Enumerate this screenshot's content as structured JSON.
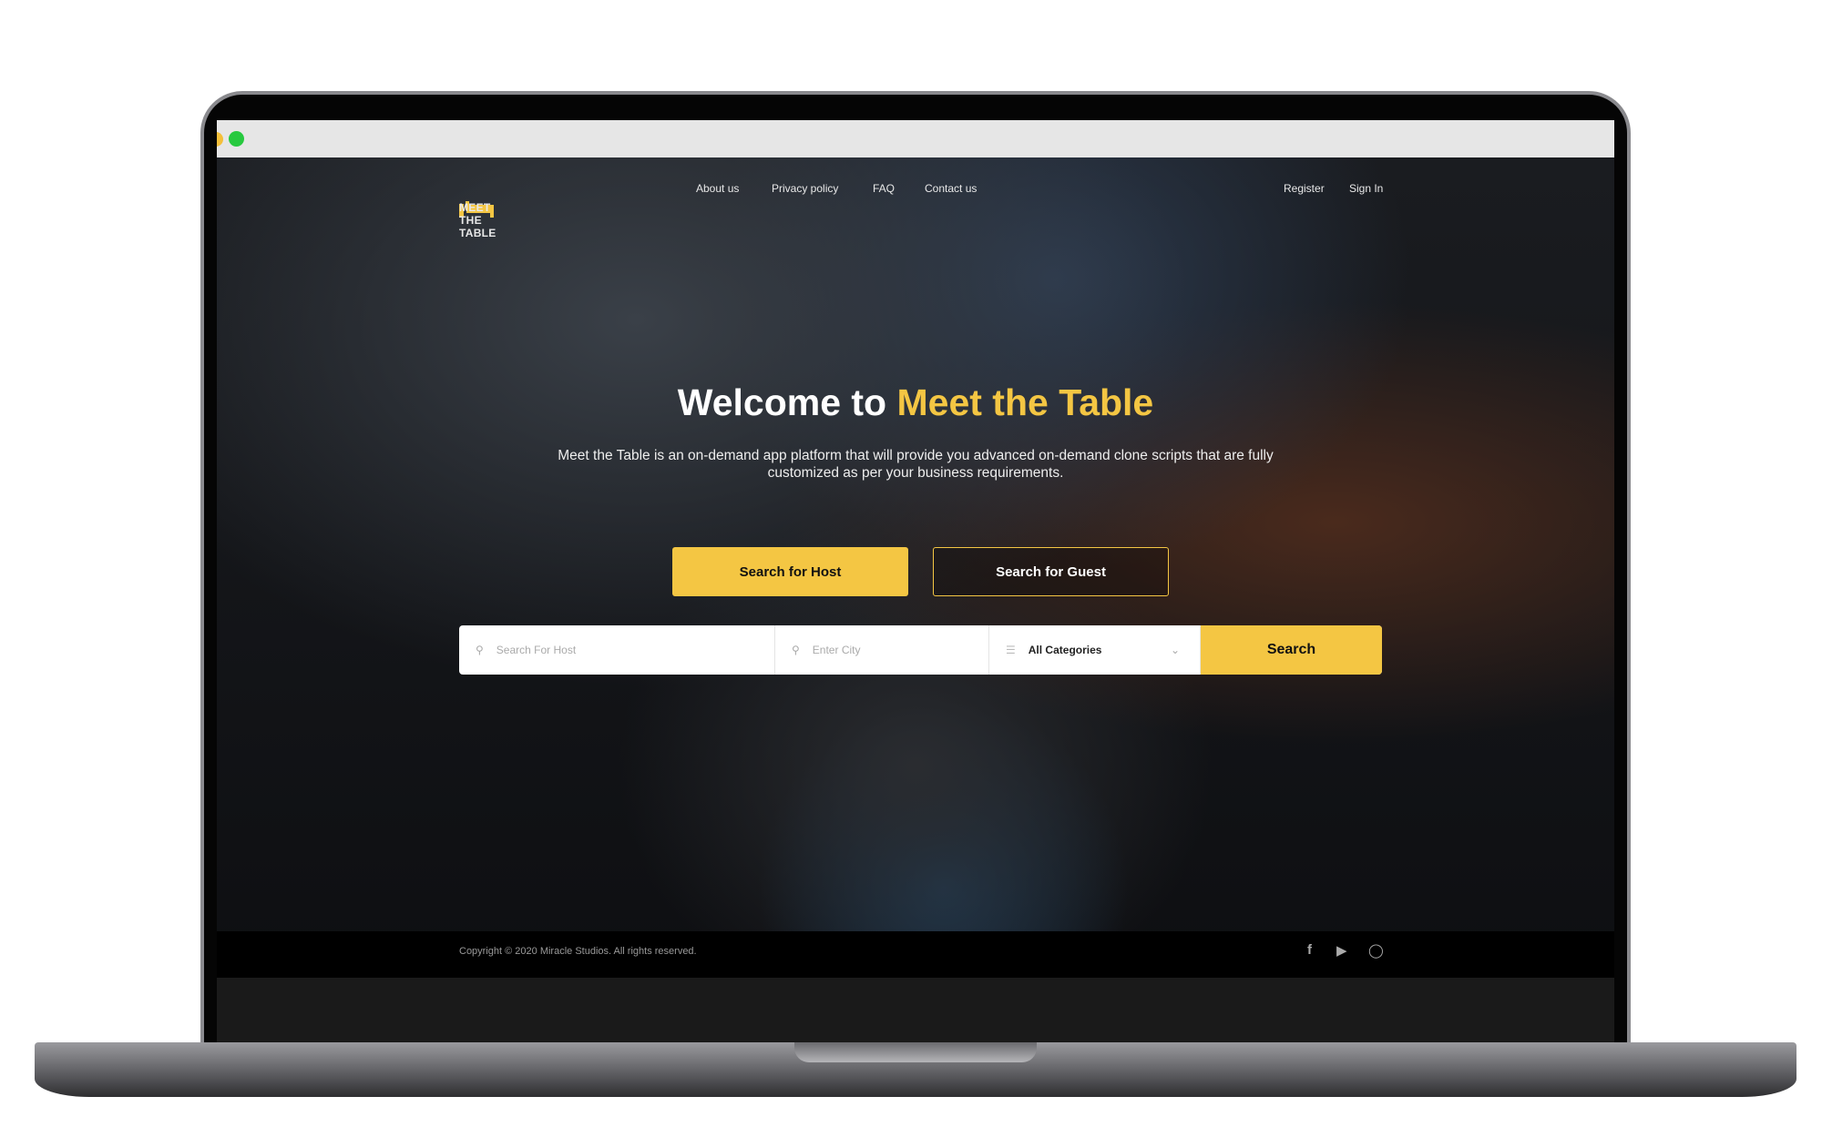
{
  "brand": {
    "name": "MEET THE TABLE",
    "accent": "#f4c643"
  },
  "nav": {
    "links": [
      "About us",
      "Privacy policy",
      "FAQ",
      "Contact us"
    ],
    "register": "Register",
    "sign_in": "Sign In"
  },
  "hero": {
    "title_prefix": "Welcome to",
    "title_accent": "Meet the Table",
    "subtitle": "Meet the Table is an on-demand app platform that will provide you advanced on-demand clone scripts that are fully customized as per your business requirements.",
    "host_button": "Search for Host",
    "guest_button": "Search for Guest"
  },
  "search": {
    "host_placeholder": "Search For Host",
    "city_placeholder": "Enter City",
    "category": "All Categories",
    "button": "Search"
  },
  "footer": {
    "copyright": "Copyright © 2020 Miracle Studios. All rights reserved.",
    "social": [
      "facebook-icon",
      "youtube-icon",
      "instagram-icon"
    ]
  }
}
